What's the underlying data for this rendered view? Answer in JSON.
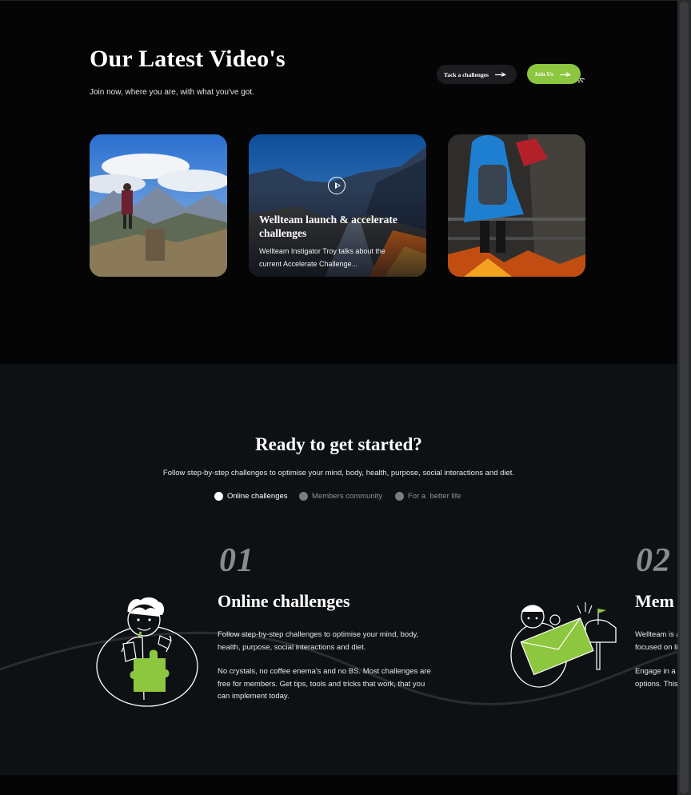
{
  "videos": {
    "title": "Our Latest Video's",
    "subtitle": "Join now, where you are, with what you've got.",
    "challenge_button": "Tack a challenges",
    "join_button": "Join Us",
    "cards": [
      {
        "scene": "hiker-on-mountain"
      },
      {
        "scene": "mountain-road",
        "title": "Wellteam launch & accelerate challenges",
        "description": "Wellteam Instigator Troy talks about the current Accelerate Challenge..."
      },
      {
        "scene": "hiker-in-rain"
      }
    ]
  },
  "started": {
    "title": "Ready to get started?",
    "subtitle": "Follow step-by-step challenges to optimise your mind, body, health, purpose, social interactions and diet.",
    "tabs": [
      {
        "label": "Online challenges",
        "active": true
      },
      {
        "label": "Members community",
        "active": false
      },
      {
        "label": "For a  better life",
        "active": false
      }
    ],
    "slides": [
      {
        "number": "01",
        "title": "Online challenges",
        "paragraph1": "Follow step-by-step challenges to optimise your mind, body, health, purpose, social interactions and diet.",
        "paragraph2": "No crystals, no coffee enema's and no BS. Most challenges are free for members. Get tips, tools and tricks that work, that you can implement today.",
        "illustration": "person-holding-puzzle-piece"
      },
      {
        "number": "02",
        "title": "Mem",
        "paragraph1": "Wellteam is a",
        "paragraph1_line2": "focused on li",
        "paragraph2": "Engage in a c",
        "paragraph2_line2": "options. This",
        "illustration": "person-with-envelope-mailbox"
      }
    ]
  },
  "colors": {
    "accent": "#8dc63f",
    "page_bg": "#050505",
    "section_bg": "#0e1114"
  }
}
